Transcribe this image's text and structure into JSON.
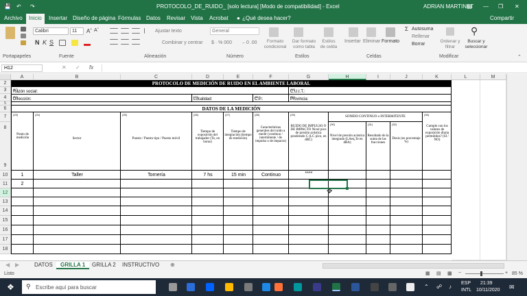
{
  "window": {
    "title": "PROTOCOLO_DE_RUIDO_ [solo lectura] [Modo de compatibilidad] - Excel",
    "user": "ADRIAN MARTINET",
    "share": "Compartir"
  },
  "ribbon_tabs": [
    "Archivo",
    "Inicio",
    "Insertar",
    "Diseño de página",
    "Fórmulas",
    "Datos",
    "Revisar",
    "Vista",
    "Acrobat"
  ],
  "tell_me": "¿Qué desea hacer?",
  "ribbon": {
    "font_name": "Calibri",
    "font_size": "11",
    "wrap_text": "Ajustar texto",
    "merge": "Combinar y centrar",
    "number_format": "General",
    "cond_format": "Formato condicional",
    "table_format": "Dar formato como tabla",
    "cell_styles": "Estilos de celda",
    "insert": "Insertar",
    "delete": "Eliminar",
    "format": "Formato",
    "autosum": "Autosuma",
    "fill": "Rellenar",
    "clear": "Borrar",
    "sort": "Ordenar y filtrar",
    "find": "Buscar y seleccionar",
    "groups": [
      "Portapapeles",
      "Fuente",
      "Alineación",
      "Número",
      "Estilos",
      "Celdas",
      "Modificar"
    ],
    "bold": "N",
    "italic": "K",
    "underline": "S"
  },
  "name_box": "H12",
  "fx": "fx",
  "columns": [
    "A",
    "B",
    "C",
    "D",
    "E",
    "F",
    "G",
    "H",
    "I",
    "J",
    "K",
    "L",
    "M"
  ],
  "rows": [
    "2",
    "3",
    "4",
    "5",
    "6",
    "7",
    "8",
    "9",
    "10",
    "11",
    "12",
    "13",
    "14",
    "15",
    "16",
    "17",
    "18"
  ],
  "form": {
    "title": "PROTOCOLO DE MEDICIÓN DE RUIDO EN EL AMBIENTE LABORAL",
    "razon": "Razón social:",
    "cuit": "C.U.I.T.:",
    "direccion": "Dirección:",
    "localidad": "Localidad:",
    "cp": "C.P.:",
    "provincia": "Provincia:",
    "n17": "(17)",
    "n18": "(18)",
    "n19": "(19)",
    "n20": "(20)",
    "n21": "(21)",
    "n22": "(22)",
    "datos": "DATOS DE LA MEDICIÓN",
    "sonido": "SONIDO CONTINUO o INTERMITENTE",
    "h_punto": "Punto de medición",
    "h_sector": "Sector",
    "h_puesto": "Puesto / Puesto tipo / Puesto móvil",
    "h_tiempo": "Tiempo de exposición del trabajador (Te, en horas)",
    "h_integ": "Tiempo de integración (tiempo de medición)",
    "h_caract": "Características generales del ruido a medir (continuo / intermitente / de impulso o de impacto)",
    "h_impulso": "RUIDO DE IMPULSO O DE IMPACTO Nivel pico de presión acústica ponderado C (LC pico, en dBC)",
    "h_nivel": "Nivel de presión acústica integrado (LAeq,Te en dBA)",
    "h_result": "Resultado de la suma de las fracciones",
    "h_dosis": "Dosis (en porcentaje %)",
    "h_cumple": "Cumple con los valores de exposición diaria permitidos? (SI / NO)",
    "cn": [
      "(23)",
      "(24)",
      "(25)",
      "(26)",
      "(27)",
      "(28)",
      "(29)",
      "(30)",
      "(31)",
      "(32)",
      "(33)"
    ]
  },
  "row10": {
    "punto": "1",
    "sector": "Taller",
    "puesto": "Tornería",
    "tiempo": "7 hs",
    "integ": "15 min",
    "caract": "Continuo",
    "impulso": "****"
  },
  "row11": {
    "punto": "2"
  },
  "sheet_tabs": [
    "DATOS",
    "GRILLA 1",
    "GRILLA 2",
    "INSTRUCTIVO"
  ],
  "active_sheet": "GRILLA 1",
  "status": "Listo",
  "zoom": "85 %",
  "taskbar": {
    "search": "Escribe aquí para buscar",
    "lang": "ESP",
    "layout": "INTL",
    "time": "21:39",
    "date": "10/11/2020"
  }
}
